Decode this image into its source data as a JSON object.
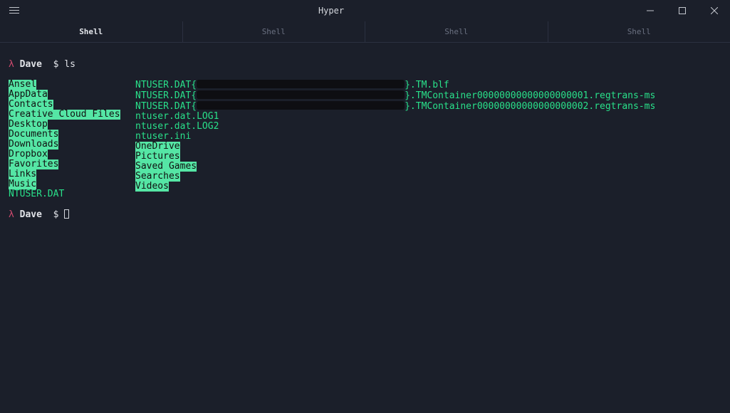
{
  "window": {
    "title": "Hyper"
  },
  "tabs": [
    {
      "label": "Shell",
      "active": true
    },
    {
      "label": "Shell",
      "active": false
    },
    {
      "label": "Shell",
      "active": false
    },
    {
      "label": "Shell",
      "active": false
    }
  ],
  "prompt": {
    "lambda": "λ",
    "user": "Dave",
    "dollar": "$",
    "cmd": "ls"
  },
  "listing": {
    "col1": [
      {
        "name": "Ansel",
        "type": "dir"
      },
      {
        "name": "AppData",
        "type": "dir"
      },
      {
        "name": "Contacts",
        "type": "dir"
      },
      {
        "name": "Creative Cloud Files",
        "type": "dir"
      },
      {
        "name": "Desktop",
        "type": "dir"
      },
      {
        "name": "Documents",
        "type": "dir"
      },
      {
        "name": "Downloads",
        "type": "dir"
      },
      {
        "name": "Dropbox",
        "type": "dir"
      },
      {
        "name": "Favorites",
        "type": "dir"
      },
      {
        "name": "Links",
        "type": "dir"
      },
      {
        "name": "Music",
        "type": "dir"
      },
      {
        "name": "NTUSER.DAT",
        "type": "file"
      }
    ],
    "col2_files_top": [
      {
        "prefix": "NTUSER.DAT{",
        "suffix": "}.TM.blf",
        "redactW": 292
      },
      {
        "prefix": "NTUSER.DAT{",
        "suffix": "}.TMContainer00000000000000000001.regtrans-ms",
        "redactW": 292
      },
      {
        "prefix": "NTUSER.DAT{",
        "suffix": "}.TMContainer00000000000000000002.regtrans-ms",
        "redactW": 292
      },
      {
        "text": "ntuser.dat.LOG1"
      },
      {
        "text": "ntuser.dat.LOG2"
      },
      {
        "text": "ntuser.ini"
      }
    ],
    "col2_dirs": [
      {
        "name": "OneDrive",
        "type": "dir"
      },
      {
        "name": "Pictures",
        "type": "dir"
      },
      {
        "name": "Saved Games",
        "type": "dir"
      },
      {
        "name": "Searches",
        "type": "dir"
      },
      {
        "name": "Videos",
        "type": "dir"
      }
    ]
  }
}
